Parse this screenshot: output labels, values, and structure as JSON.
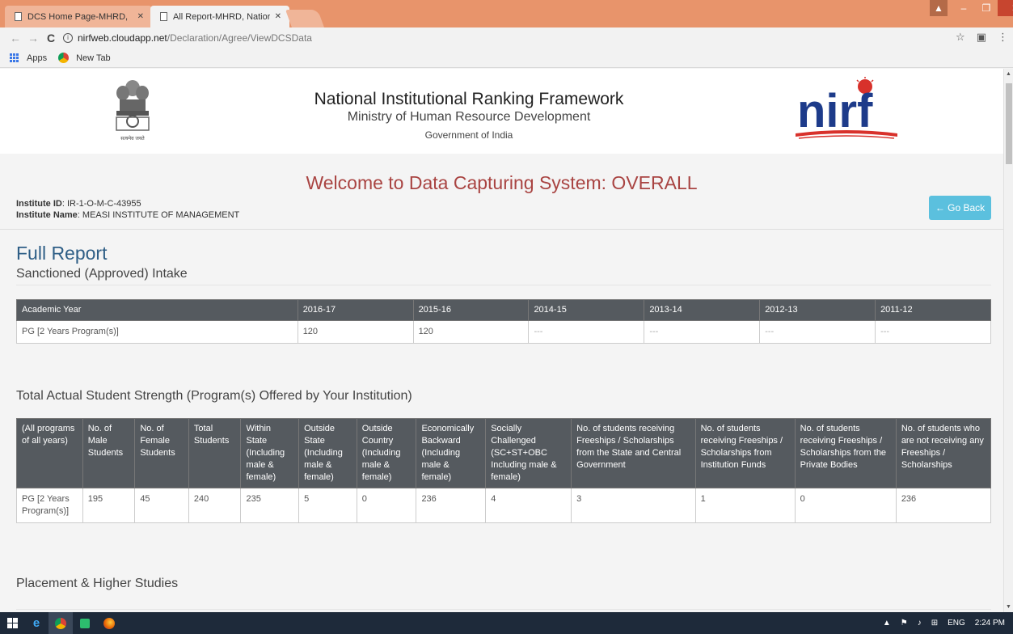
{
  "browser": {
    "tabs": [
      {
        "title": "DCS Home Page-MHRD,"
      },
      {
        "title": "All Report-MHRD, Natior"
      }
    ],
    "url_host": "nirfweb.cloudapp.net",
    "url_path": "/Declaration/Agree/ViewDCSData",
    "bookmarks": [
      {
        "label": "Apps"
      },
      {
        "label": "New Tab"
      }
    ]
  },
  "header": {
    "title": "National Institutional Ranking Framework",
    "subtitle1": "Ministry of Human Resource Development",
    "subtitle2": "Government of India",
    "emblem_caption": "सत्यमेव जयते",
    "logo_text": "nirf"
  },
  "welcome": "Welcome to Data Capturing System: OVERALL",
  "institute": {
    "id_label": "Institute ID",
    "id": ": IR-1-O-M-C-43955",
    "name_label": "Institute Name",
    "name": ": MEASI INSTITUTE OF MANAGEMENT"
  },
  "go_back": "← Go Back",
  "full_report": "Full Report",
  "intake": {
    "title": "Sanctioned (Approved) Intake",
    "headers": [
      "Academic Year",
      "2016-17",
      "2015-16",
      "2014-15",
      "2013-14",
      "2012-13",
      "2011-12"
    ],
    "rows": [
      [
        "PG [2 Years Program(s)]",
        "120",
        "120",
        "---",
        "---",
        "---",
        "---"
      ]
    ]
  },
  "strength": {
    "title": "Total Actual Student Strength (Program(s) Offered by Your Institution)",
    "headers": [
      "(All programs of all years)",
      "No. of Male Students",
      "No. of Female Students",
      "Total Students",
      "Within State (Including male & female)",
      "Outside State (Including male & female)",
      "Outside Country (Including male & female)",
      "Economically Backward (Including male & female)",
      "Socially Challenged (SC+ST+OBC Including male & female)",
      "No. of students receiving Freeships / Scholarships from the State and Central Government",
      "No. of students receiving Freeships / Scholarships from Institution Funds",
      "No. of students receiving Freeships / Scholarships from the Private Bodies",
      "No. of students who are not receiving any Freeships / Scholarships"
    ],
    "rows": [
      [
        "PG [2 Years Program(s)]",
        "195",
        "45",
        "240",
        "235",
        "5",
        "0",
        "236",
        "4",
        "3",
        "1",
        "0",
        "236"
      ]
    ]
  },
  "placement": {
    "title": "Placement & Higher Studies"
  },
  "taskbar": {
    "lang": "ENG",
    "time": "2:24 PM"
  }
}
